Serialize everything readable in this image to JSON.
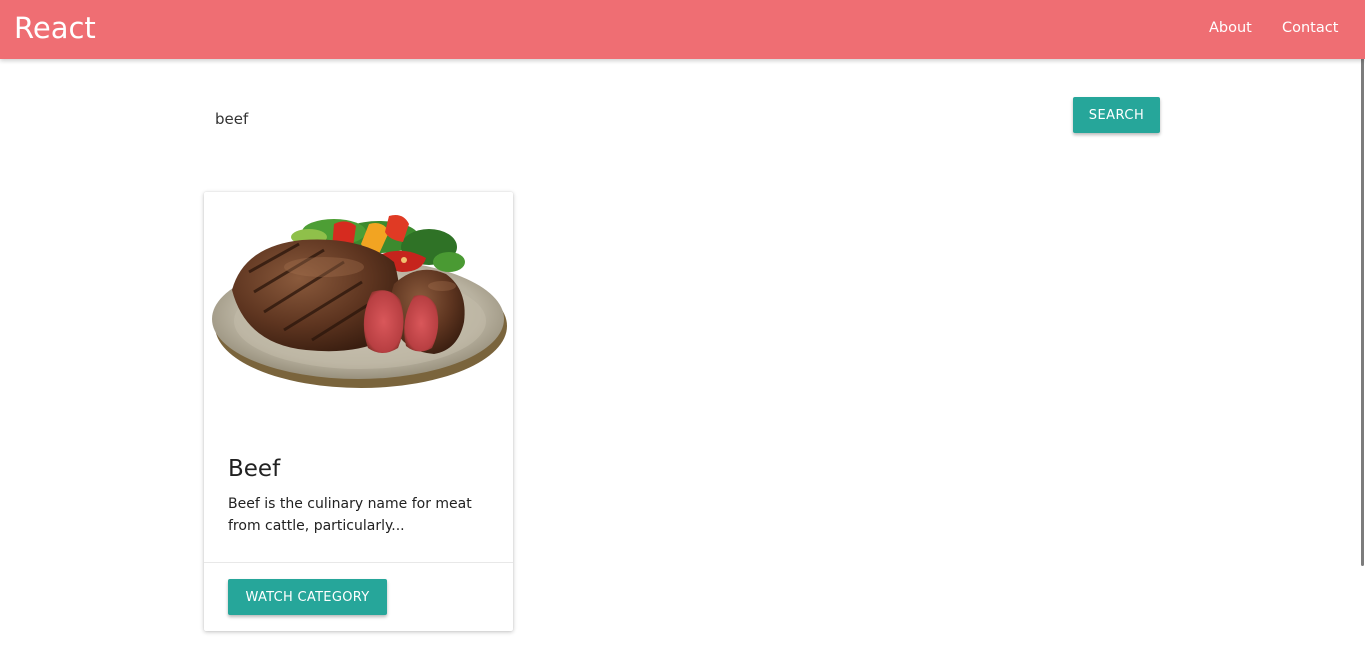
{
  "navbar": {
    "brand": "React",
    "links": [
      {
        "label": "About"
      },
      {
        "label": "Contact"
      }
    ]
  },
  "search": {
    "value": "beef",
    "button_label": "SEARCH"
  },
  "results": [
    {
      "title": "Beef",
      "description": "Beef is the culinary name for meat from cattle, particularly...",
      "button_label": "WATCH CATEGORY",
      "image_icon": "beef-steak-image"
    }
  ],
  "colors": {
    "navbar_bg": "#ef6e73",
    "accent": "#26a69a"
  }
}
